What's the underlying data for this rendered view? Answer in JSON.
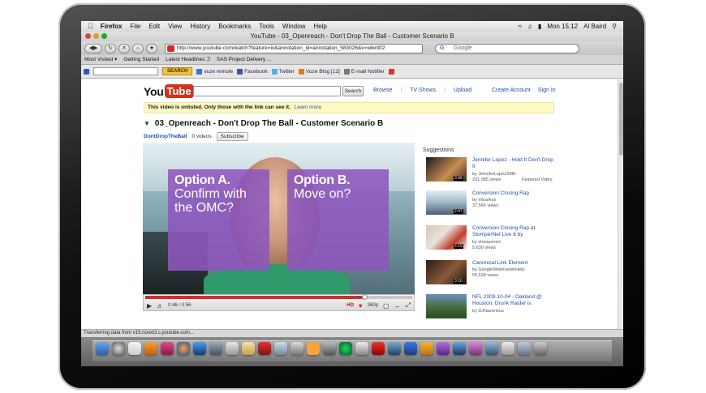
{
  "os_menu": {
    "app": "Firefox",
    "items": [
      "File",
      "Edit",
      "View",
      "History",
      "Bookmarks",
      "Tools",
      "Window",
      "Help"
    ],
    "clock": "Mon 15:12",
    "user": "Al Baird"
  },
  "window": {
    "title": "YouTube - 03_Openreach - Don't Drop The Ball - Customer Scenario B"
  },
  "navbar": {
    "url": "http://www.youtube.com/watch?feature=iv&annotation_id=annotation_583026&v=wlkrit02",
    "search_placeholder": "Google",
    "search_engine_icon": "google-icon"
  },
  "bookmarks": [
    "Most Visited ▾",
    "Getting Started",
    "Latest Headlines ℑ",
    "SAS Project Delivery ..."
  ],
  "addon_toolbar": {
    "search_label": "SEARCH",
    "items": [
      "vuze remote",
      "Facebook",
      "Twitter",
      "Vuze Blog [12]",
      "E-mail Notifier"
    ]
  },
  "youtube": {
    "logo_you": "You",
    "logo_tube": "Tube",
    "search_button": "Search",
    "nav": [
      "Browse",
      "TV Shows",
      "Upload"
    ],
    "user_links": [
      "Create Account",
      "Sign In"
    ],
    "notice_bold": "This video is unlisted. Only those with the link can see it.",
    "notice_link": "Learn more",
    "video_title": "03_Openreach - Don't Drop The Ball - Customer Scenario B",
    "channel": "DontDropTheBall",
    "channel_videos": "0 videos",
    "subscribe": "Subscribe"
  },
  "player": {
    "option_a_head": "Option A.",
    "option_a_body": "Confirm with the OMC?",
    "option_b_head": "Option B.",
    "option_b_body": "Move on?",
    "time": "0:46 / 0:56",
    "progress": 0.82,
    "quality": "360p"
  },
  "suggestions": {
    "title": "Suggestions",
    "items": [
      {
        "title": "Jennifer Lopez - Hold It Don't Drop It",
        "by": "by JenniferLopezSME",
        "views": "231,085 views",
        "extra": "Featured Video",
        "duration": "3:58"
      },
      {
        "title": "Conversion Closing Rap",
        "by": "by mlsarkos",
        "views": "37,566 views",
        "extra": "",
        "duration": "2:47"
      },
      {
        "title": "Conversion Closing Rap at StomperNet Live 6 by",
        "by": "by stompernet",
        "views": "5,630 views",
        "extra": "",
        "duration": "2:19"
      },
      {
        "title": "Canonical Link Element",
        "by": "by GoogleWebmasterHelp",
        "views": "55,628 views",
        "extra": "",
        "duration": "3:16"
      },
      {
        "title": "NFL 2009-10-04 - Oakland @ Houston: Drunk Raider is",
        "by": "by DJNazorious",
        "views": "",
        "extra": "",
        "duration": ""
      }
    ]
  },
  "status": "Transferring data from v15.nonxt3.c.youtube.com..."
}
